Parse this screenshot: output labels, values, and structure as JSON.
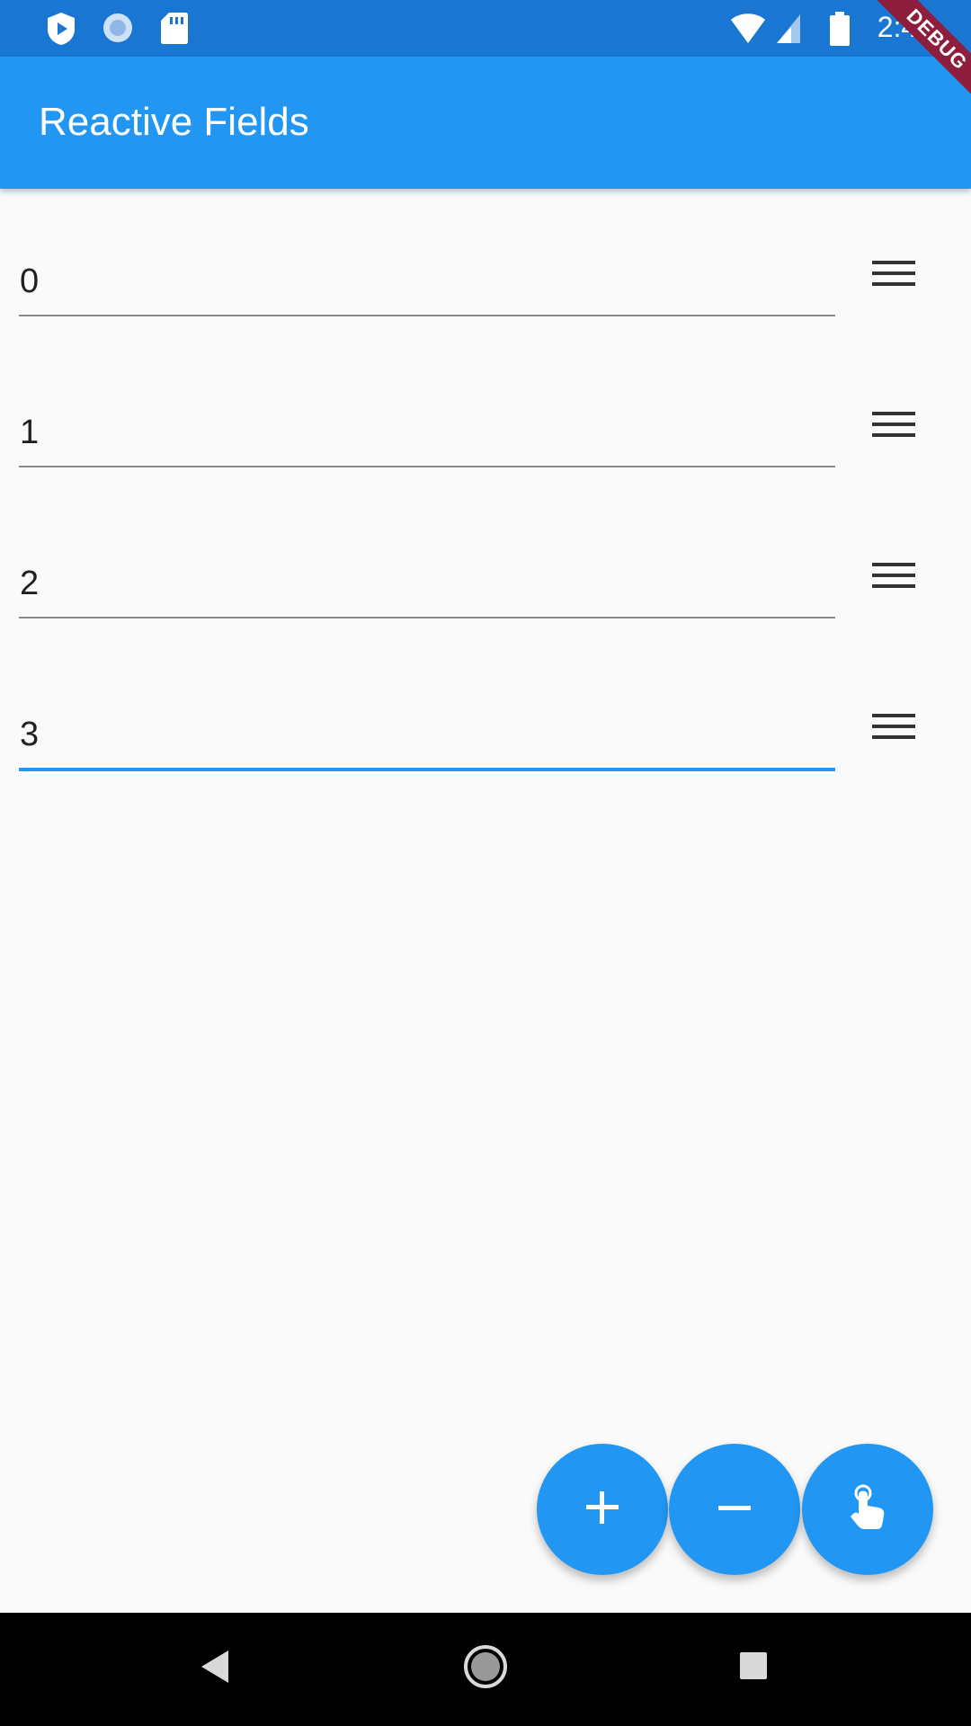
{
  "status_bar": {
    "time": "2:41",
    "icons": [
      "play-protect-icon",
      "sync-icon",
      "sd-card-icon",
      "wifi-icon",
      "signal-icon",
      "battery-icon"
    ]
  },
  "debug_banner": "DEBUG",
  "app_bar": {
    "title": "Reactive Fields"
  },
  "fields": [
    {
      "value": "0",
      "focused": false
    },
    {
      "value": "1",
      "focused": false
    },
    {
      "value": "2",
      "focused": false
    },
    {
      "value": "3",
      "focused": true
    }
  ],
  "fabs": [
    {
      "icon": "add-icon"
    },
    {
      "icon": "remove-icon"
    },
    {
      "icon": "touch-icon"
    }
  ],
  "colors": {
    "primary": "#2196F3",
    "primary_dark": "#1976D2",
    "background": "#fafafa"
  }
}
